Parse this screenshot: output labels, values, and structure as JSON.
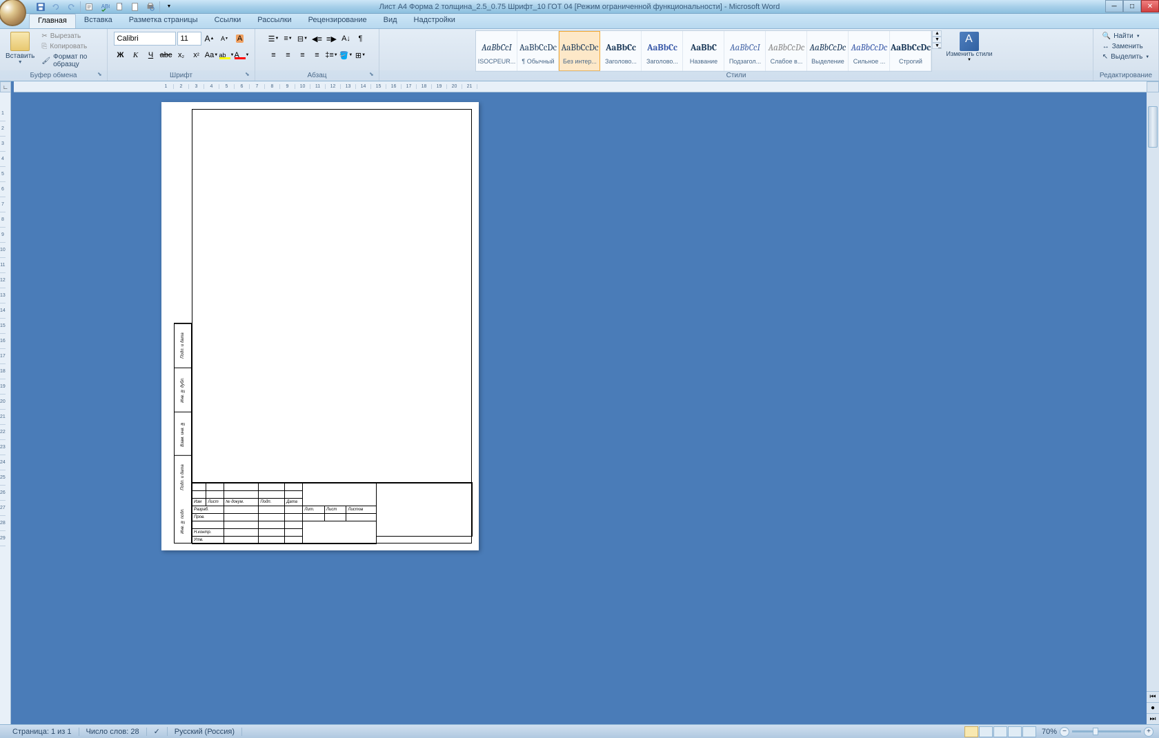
{
  "title": "Лист А4 Форма 2 толщина_2.5_0.75 Шрифт_10 ГОТ 04 [Режим ограниченной функциональности] - Microsoft Word",
  "tabs": {
    "home": "Главная",
    "insert": "Вставка",
    "pageLayout": "Разметка страницы",
    "references": "Ссылки",
    "mailings": "Рассылки",
    "review": "Рецензирование",
    "view": "Вид",
    "addins": "Надстройки"
  },
  "clipboard": {
    "paste": "Вставить",
    "cut": "Вырезать",
    "copy": "Копировать",
    "formatPainter": "Формат по образцу",
    "groupLabel": "Буфер обмена"
  },
  "font": {
    "name": "Calibri",
    "size": "11",
    "groupLabel": "Шрифт",
    "bold": "Ж",
    "italic": "К",
    "underline": "Ч",
    "strike": "abc"
  },
  "paragraph": {
    "groupLabel": "Абзац"
  },
  "styles": {
    "groupLabel": "Стили",
    "changeStyles": "Изменить стили",
    "items": [
      {
        "preview": "AaBbCcI",
        "name": "ISOCPEUR...",
        "bold": false,
        "italic": true,
        "color": "#1a3858"
      },
      {
        "preview": "AaBbCcDc",
        "name": "¶ Обычный",
        "bold": false,
        "italic": false,
        "color": "#1a3858"
      },
      {
        "preview": "AaBbCcDc",
        "name": "Без интер...",
        "bold": false,
        "italic": false,
        "color": "#1a3858"
      },
      {
        "preview": "AaBbCc",
        "name": "Заголово...",
        "bold": true,
        "italic": false,
        "color": "#1a3858"
      },
      {
        "preview": "AaBbCc",
        "name": "Заголово...",
        "bold": true,
        "italic": false,
        "color": "#3858a8"
      },
      {
        "preview": "AaBbC",
        "name": "Название",
        "bold": true,
        "italic": false,
        "color": "#1a3858"
      },
      {
        "preview": "AaBbCcI",
        "name": "Подзагол...",
        "bold": false,
        "italic": true,
        "color": "#4868a8"
      },
      {
        "preview": "AaBbCcDc",
        "name": "Слабое в...",
        "bold": false,
        "italic": true,
        "color": "#888"
      },
      {
        "preview": "AaBbCcDc",
        "name": "Выделение",
        "bold": false,
        "italic": true,
        "color": "#1a3858"
      },
      {
        "preview": "AaBbCcDc",
        "name": "Сильное ...",
        "bold": false,
        "italic": true,
        "color": "#3858a8"
      },
      {
        "preview": "AaBbCcDc",
        "name": "Строгий",
        "bold": true,
        "italic": false,
        "color": "#1a3858"
      }
    ]
  },
  "editing": {
    "find": "Найти",
    "replace": "Заменить",
    "select": "Выделить",
    "groupLabel": "Редактирование"
  },
  "statusbar": {
    "page": "Страница: 1 из 1",
    "words": "Число слов: 28",
    "language": "Русский (Россия)",
    "zoom": "70%"
  },
  "document": {
    "sideStamp": [
      "Подп. и дата",
      "Инв. № дубл.",
      "Взам. инв. №",
      "Подп. и дата",
      "Инв. № подл."
    ],
    "titleBlock": {
      "headers": [
        "Изм",
        "Лист",
        "№ докум.",
        "Подп.",
        "Дата"
      ],
      "rows": [
        "Разраб.",
        "Пров.",
        "",
        "Н.контр.",
        "Утв."
      ],
      "topRight": [
        "Лит.",
        "Лист",
        "Листов"
      ]
    }
  }
}
